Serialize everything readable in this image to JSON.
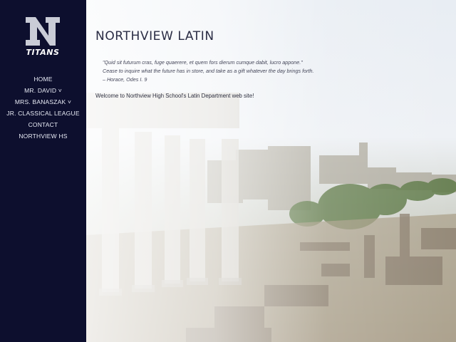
{
  "logo": {
    "text": "TITANS",
    "icon": "titans-logo-icon",
    "letter": "N"
  },
  "nav": {
    "items": [
      {
        "label": "HOME"
      },
      {
        "label": "MR. DAVID ˅"
      },
      {
        "label": "MRS. BANASZAK ˅"
      },
      {
        "label": "JR. CLASSICAL LEAGUE"
      },
      {
        "label": "CONTACT"
      },
      {
        "label": "NORTHVIEW HS"
      }
    ]
  },
  "main": {
    "title": "NORTHVIEW LATIN",
    "quote_lines": [
      "\"Quid sit futurum cras, fuge quaerere, et quem fors dierum cumque dabit, lucro appone.\"",
      "Cease to inquire what the future has in store, and take as a gift whatever the day brings forth.",
      "– Horace, Odes I. 9"
    ],
    "welcome": "Welcome to Northview High School's Latin Department web site!"
  },
  "colors": {
    "sidebar": "#0d0f2e",
    "text": "#2a2c44"
  }
}
